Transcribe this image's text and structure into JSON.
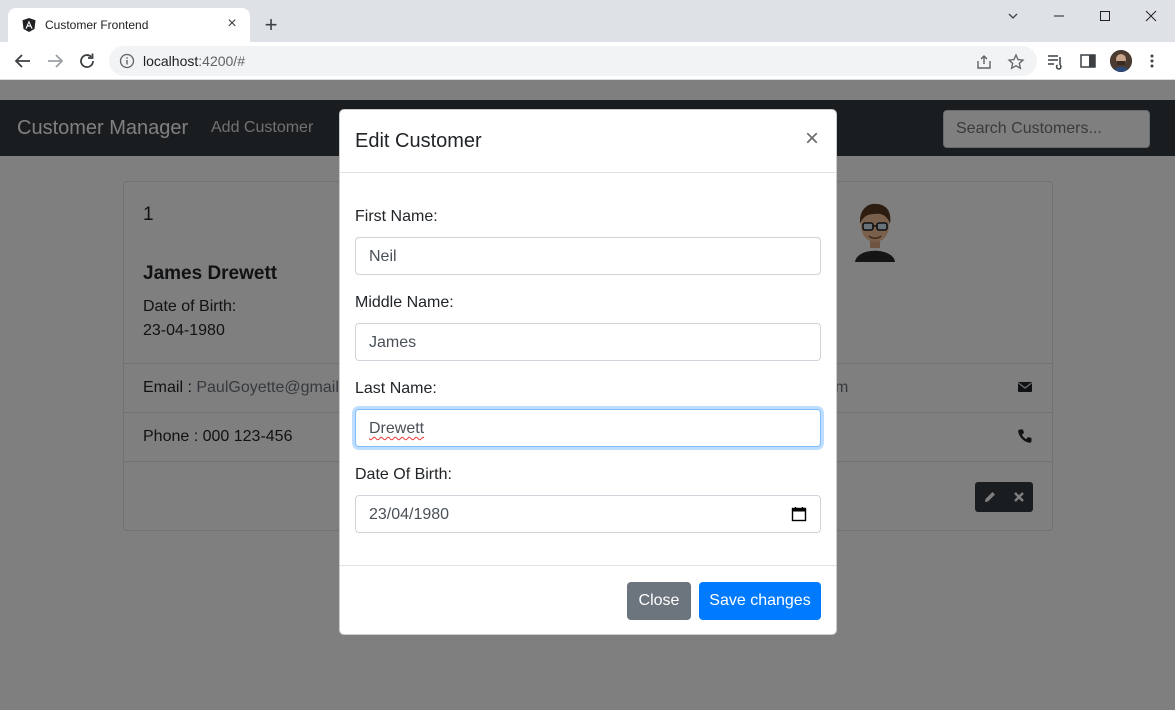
{
  "browser": {
    "tab_title": "Customer Frontend",
    "url_host": "localhost",
    "url_rest": ":4200/#",
    "new_tab_label": "+",
    "tab_close_label": "×"
  },
  "navbar": {
    "brand": "Customer Manager",
    "add_customer": "Add Customer",
    "search_placeholder": "Search Customers..."
  },
  "card": {
    "id": "1",
    "name": "James Drewett",
    "dob_label": "Date of Birth:",
    "dob": "23-04-1980",
    "email_label": "Email : ",
    "email": "PaulGoyette@gmail.c",
    "email_tail": "m",
    "phone_label": "Phone : 000 123-456"
  },
  "modal": {
    "title": "Edit Customer",
    "close_label": "×",
    "first_name_label": "First Name:",
    "first_name": "Neil",
    "middle_name_label": "Middle Name:",
    "middle_name": "James",
    "last_name_label": "Last Name:",
    "last_name": "Drewett",
    "dob_label": "Date Of Birth:",
    "dob": "23/04/1980",
    "close_button": "Close",
    "save_button": "Save changes"
  }
}
